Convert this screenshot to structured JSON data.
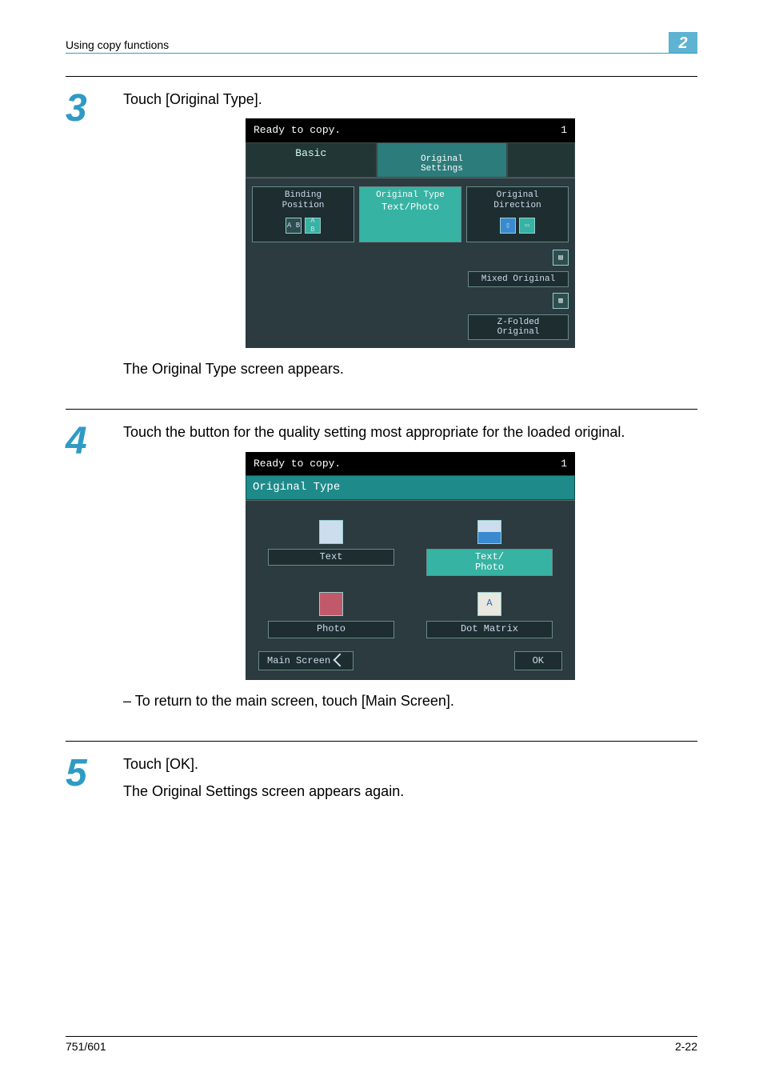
{
  "header": {
    "section": "Using copy functions",
    "chapter": "2"
  },
  "steps": {
    "s3": {
      "num": "3",
      "text": "Touch [Original Type].",
      "after": "The Original Type screen appears."
    },
    "s4": {
      "num": "4",
      "text": "Touch the button for the quality setting most appropriate for the loaded original.",
      "bullet": "To return to the main screen, touch [Main Screen]."
    },
    "s5": {
      "num": "5",
      "text": "Touch [OK].",
      "after": "The Original Settings screen appears again."
    }
  },
  "screen1": {
    "status": "Ready to copy.",
    "count": "1",
    "tab_basic": "Basic",
    "tab_settings": "Original\nSettings",
    "card_binding": "Binding\nPosition",
    "card_type_title": "Original Type",
    "card_type_value": "Text/Photo",
    "card_direction": "Original\nDirection",
    "btn_mixed": "Mixed Original",
    "btn_zfold": "Z-Folded\nOriginal"
  },
  "screen2": {
    "status": "Ready to copy.",
    "count": "1",
    "title": "Original Type",
    "opt_text": "Text",
    "opt_textphoto": "Text/\nPhoto",
    "opt_photo": "Photo",
    "opt_dot": "Dot Matrix",
    "btn_main": "Main Screen",
    "btn_ok": "OK"
  },
  "footer": {
    "left": "751/601",
    "right": "2-22"
  }
}
